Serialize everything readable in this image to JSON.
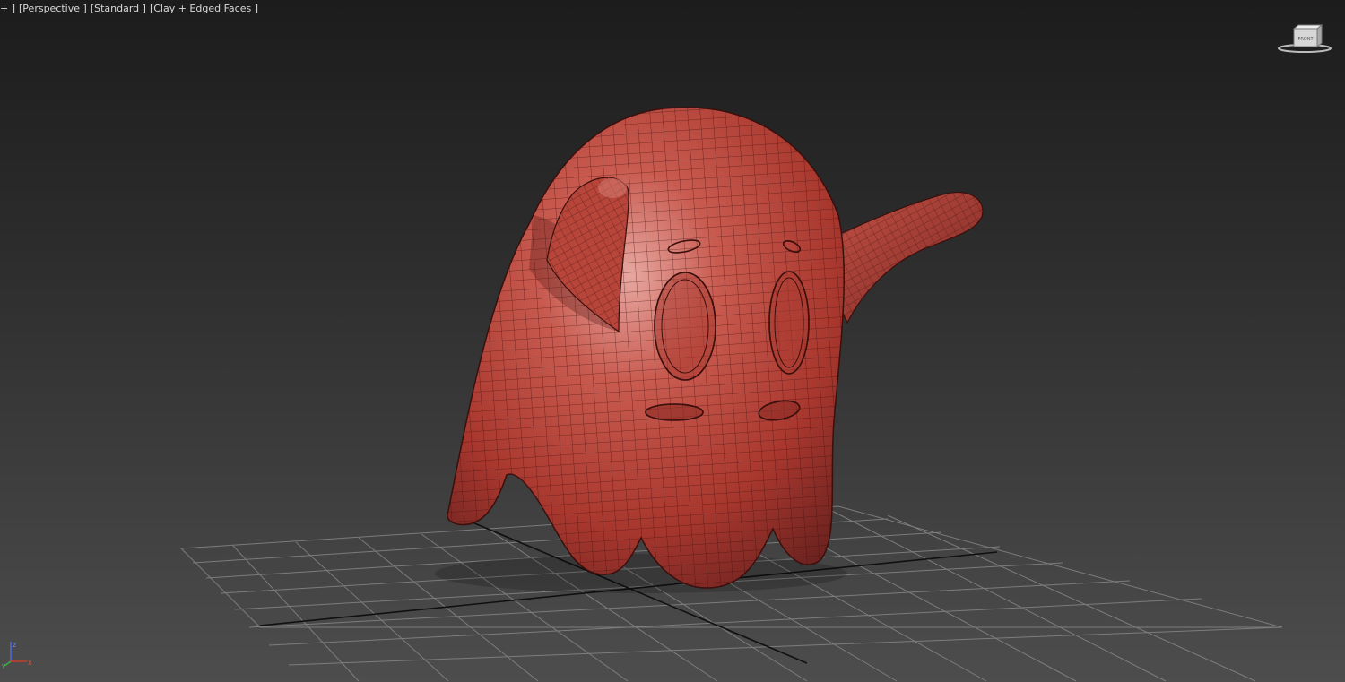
{
  "viewport": {
    "label_parts": [
      "+ ]",
      "[Perspective ]",
      "[Standard ]",
      "[Clay + Edged Faces ]"
    ],
    "view_name": "Perspective",
    "shading_preset": "Standard",
    "display_mode": "Clay + Edged Faces"
  },
  "viewcube": {
    "face_label": "FRONT",
    "icon": "viewcube-icon"
  },
  "axis_tripod": {
    "x": "x",
    "y": "y",
    "z": "z",
    "icon": "axis-tripod-icon"
  },
  "colors": {
    "mesh_base": "#b9443a",
    "mesh_shadow": "#6e2320",
    "mesh_highlight": "#e7a7a0",
    "wire": "#3b0f0c",
    "grid": "#8a8a8a",
    "grid_axis": "#101010",
    "axis_x": "#d03a2a",
    "axis_y": "#38b040",
    "axis_z": "#4a6de0"
  }
}
